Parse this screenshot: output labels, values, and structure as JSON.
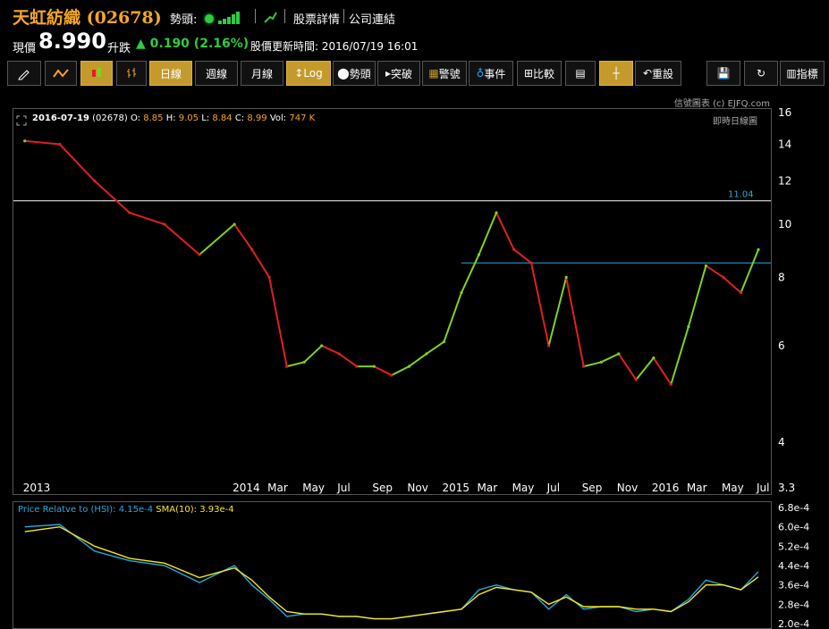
{
  "header": {
    "title": "天虹紡織 (02678)",
    "trend_label": "勢頭:",
    "links": [
      "股票詳情",
      "公司連結"
    ]
  },
  "quote": {
    "price_label": "現價",
    "price": "8.990",
    "change_label": "升跌",
    "change": "0.190 (2.16%)",
    "update_label": "股價更新時間:",
    "update_time": "2016/07/19 16:01"
  },
  "toolbar": {
    "buttons": [
      "日線",
      "週線",
      "月線",
      "Log",
      "勢頭",
      "突破",
      "警號",
      "事件",
      "比較",
      "重設",
      "指標"
    ]
  },
  "credit": "信號圖表 (c) EJFQ.com",
  "realtime_label": "即時日線圖",
  "ohlc": {
    "date": "2016-07-19",
    "code": "(02678)",
    "o_label": "O:",
    "o": "8.85",
    "h_label": "H:",
    "h": "9.05",
    "l_label": "L:",
    "l": "8.84",
    "c_label": "C:",
    "c": "8.99",
    "vol_label": "Vol:",
    "vol": "747 K"
  },
  "relative": {
    "label": "Price Relatve to (HSI):",
    "value": "4.15e-4",
    "sma_label": "SMA(10):",
    "sma_value": "3.93e-4"
  },
  "colors": {
    "up": "#7ed321",
    "down": "#e02020",
    "accent": "#f5a623",
    "hline": "#ffffff",
    "hline2": "#29a9e0",
    "rel": "#29a9e0",
    "sma": "#f8e71c"
  },
  "chart_data": [
    {
      "type": "line",
      "scale": "log",
      "ylim": [
        3.3,
        16
      ],
      "yticks": [
        16,
        14,
        12,
        10,
        8,
        6,
        4,
        3.3
      ],
      "x_tick_labels": [
        "2013",
        "2014",
        "Mar",
        "May",
        "Jul",
        "Sep",
        "Nov",
        "2015",
        "Mar",
        "May",
        "Jul",
        "Sep",
        "Nov",
        "2016",
        "Mar",
        "May",
        "Jul"
      ],
      "annotations": [
        {
          "type": "hline",
          "value": 11.04,
          "label": "11.04"
        },
        {
          "type": "hline",
          "value": 8.5,
          "label": ""
        }
      ],
      "series": [
        {
          "x": [
            "2013-01",
            "2013-03",
            "2013-05",
            "2013-07",
            "2013-09",
            "2013-11",
            "2014-01",
            "2014-02",
            "2014-03",
            "2014-04",
            "2014-05",
            "2014-06",
            "2014-07",
            "2014-08",
            "2014-09",
            "2014-10",
            "2014-11",
            "2014-12",
            "2015-01",
            "2015-02",
            "2015-03",
            "2015-04",
            "2015-05",
            "2015-06",
            "2015-07",
            "2015-08",
            "2015-09",
            "2015-10",
            "2015-11",
            "2015-12",
            "2016-01",
            "2016-02",
            "2016-03",
            "2016-04",
            "2016-05",
            "2016-06",
            "2016-07"
          ],
          "values": [
            14.2,
            14.0,
            12.0,
            10.5,
            10.0,
            8.8,
            10.0,
            9.0,
            8.0,
            5.5,
            5.6,
            6.0,
            5.8,
            5.5,
            5.5,
            5.3,
            5.5,
            5.8,
            6.1,
            7.5,
            8.8,
            10.5,
            9.0,
            8.5,
            6.0,
            8.0,
            5.5,
            5.6,
            5.8,
            5.2,
            5.7,
            5.1,
            6.5,
            8.4,
            8.0,
            7.5,
            8.99
          ]
        }
      ]
    },
    {
      "type": "line",
      "yticks": [
        "6.8e-4",
        "6.0e-4",
        "5.2e-4",
        "4.4e-4",
        "3.6e-4",
        "2.8e-4",
        "2.0e-4"
      ],
      "ylim": [
        0.0002,
        0.00068
      ],
      "x": [
        "2013-01",
        "2013-03",
        "2013-05",
        "2013-07",
        "2013-09",
        "2013-11",
        "2014-01",
        "2014-02",
        "2014-03",
        "2014-04",
        "2014-05",
        "2014-06",
        "2014-07",
        "2014-08",
        "2014-09",
        "2014-10",
        "2014-11",
        "2014-12",
        "2015-01",
        "2015-02",
        "2015-03",
        "2015-04",
        "2015-05",
        "2015-06",
        "2015-07",
        "2015-08",
        "2015-09",
        "2015-10",
        "2015-11",
        "2015-12",
        "2016-01",
        "2016-02",
        "2016-03",
        "2016-04",
        "2016-05",
        "2016-06",
        "2016-07"
      ],
      "series": [
        {
          "name": "Price Relatve to (HSI)",
          "values": [
            0.0006,
            0.00061,
            0.0005,
            0.00046,
            0.00044,
            0.00037,
            0.00044,
            0.00036,
            0.0003,
            0.00023,
            0.00024,
            0.00024,
            0.00023,
            0.00023,
            0.00022,
            0.00022,
            0.00023,
            0.00024,
            0.00025,
            0.00026,
            0.00034,
            0.00036,
            0.00034,
            0.00033,
            0.00026,
            0.00032,
            0.00026,
            0.00027,
            0.00027,
            0.00025,
            0.00026,
            0.00025,
            0.0003,
            0.00038,
            0.00036,
            0.00034,
            0.000415
          ]
        },
        {
          "name": "SMA(10)",
          "values": [
            0.00058,
            0.0006,
            0.00052,
            0.00047,
            0.00045,
            0.00039,
            0.00043,
            0.00038,
            0.00031,
            0.00025,
            0.00024,
            0.00024,
            0.00023,
            0.00023,
            0.00022,
            0.00022,
            0.00023,
            0.00024,
            0.00025,
            0.00026,
            0.00032,
            0.00035,
            0.00034,
            0.00033,
            0.00028,
            0.00031,
            0.00027,
            0.00027,
            0.00027,
            0.00026,
            0.00026,
            0.00025,
            0.00029,
            0.00036,
            0.00036,
            0.00034,
            0.000393
          ]
        }
      ]
    }
  ]
}
